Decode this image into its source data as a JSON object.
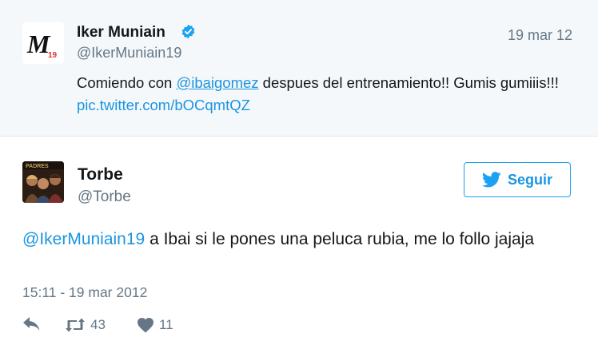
{
  "parent_tweet": {
    "name": "Iker Muniain",
    "handle": "@IkerMuniain19",
    "date": "19 mar 12",
    "text_before": "Comiendo con ",
    "mention": "@ibaigomez",
    "text_after": " despues del entrenamiento!! Gumis gumiiis!!! ",
    "link": "pic.twitter.com/bOCqmtQZ",
    "avatar_mark": "M",
    "avatar_number": "19"
  },
  "main_tweet": {
    "name": "Torbe",
    "handle": "@Torbe",
    "follow_label": "Seguir",
    "mention": "@IkerMuniain19",
    "text": " a Ibai si le pones una peluca rubia, me lo follo jajaja",
    "timestamp": "15:11 - 19 mar 2012",
    "retweets": "43",
    "likes": "11"
  },
  "icons": {
    "verified": "verified-badge-icon",
    "bird": "twitter-bird-icon",
    "reply": "reply-icon",
    "retweet": "retweet-icon",
    "like": "heart-icon"
  },
  "colors": {
    "accent": "#1da1f2",
    "link": "#1b95e0",
    "muted": "#657786",
    "parent_bg": "#f5f8fa"
  }
}
